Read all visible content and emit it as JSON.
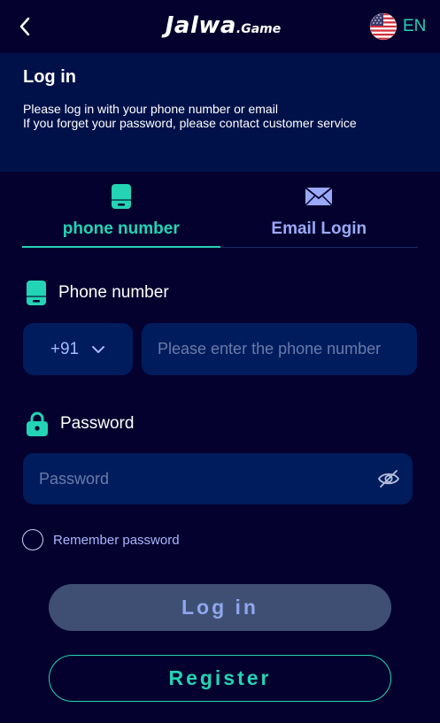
{
  "header": {
    "back_icon": "chevron-left-icon",
    "logo_main": "Jalwa",
    "logo_sub": ".Game",
    "language": {
      "flag_icon": "us-flag-icon",
      "code": "EN"
    }
  },
  "intro": {
    "title": "Log in",
    "line1": "Please log in with your phone number or email",
    "line2": "If you forget your password, please contact customer service"
  },
  "tabs": [
    {
      "label": "phone number",
      "icon": "phone-icon",
      "active": true
    },
    {
      "label": "Email Login",
      "icon": "envelope-icon",
      "active": false
    }
  ],
  "phone_field": {
    "label": "Phone number",
    "icon": "phone-icon",
    "country_code": "+91",
    "placeholder": "Please enter the phone number",
    "value": ""
  },
  "password_field": {
    "label": "Password",
    "icon": "lock-icon",
    "placeholder": "Password",
    "value": "",
    "toggle_icon": "eye-off-icon"
  },
  "remember": {
    "label": "Remember password",
    "checked": false
  },
  "buttons": {
    "login": "Log in",
    "register": "Register"
  },
  "colors": {
    "background": "#05012e",
    "panel": "#001149",
    "input": "#001c5c",
    "accent": "#23d4b4",
    "muted_text": "#a8b6ff",
    "login_button": "#3f4f73"
  }
}
